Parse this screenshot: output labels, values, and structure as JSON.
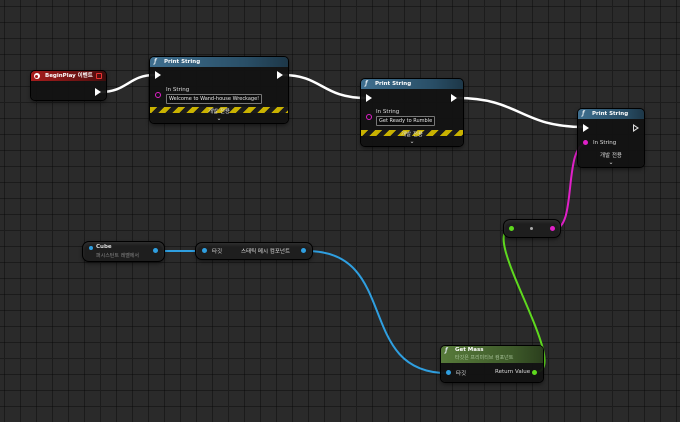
{
  "begin_play": {
    "title": "BeginPlay 이벤트"
  },
  "print1": {
    "title": "Print String",
    "pin_label": "In String",
    "value": "Welcome to Wand-house Wreckage!",
    "dev_label": "개발 전용"
  },
  "print2": {
    "title": "Print String",
    "pin_label": "In String",
    "value": "Get Ready to Rumble",
    "dev_label": "개발 전용"
  },
  "print3": {
    "title": "Print String",
    "pin_label": "In String",
    "dev_label": "개발 전용"
  },
  "cube": {
    "title": "Cube",
    "subtitle": "퍼시스턴트 레벨에서"
  },
  "smc_getter": {
    "target_label": "타깃",
    "output_label": "스태틱 메시 컴포넌트"
  },
  "get_mass": {
    "title": "Get Mass",
    "subtitle": "타깃은 프리미티브 컴포넌트",
    "target_label": "타깃",
    "output_label": "Return Value"
  },
  "colors": {
    "exec_wire": "#ffffff",
    "object_wire": "#2f9fe0",
    "float_wire": "#5ed91e",
    "string_wire": "#e020c8",
    "event_header": "#a81d1d",
    "function_header": "#3f6f8f",
    "pure_header": "#577a3a"
  }
}
